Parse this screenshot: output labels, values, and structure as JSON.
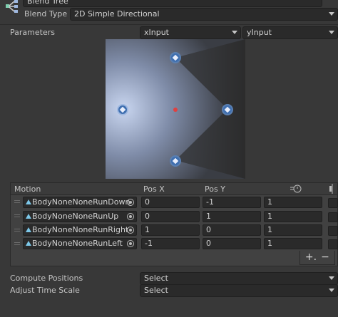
{
  "header": {
    "tree_name": "Blend Tree",
    "blend_type_label": "Blend Type",
    "blend_type_value": "2D Simple Directional"
  },
  "parameters": {
    "label": "Parameters",
    "x_param": "xInput",
    "y_param": "yInput"
  },
  "table": {
    "headers": {
      "motion": "Motion",
      "pos_x": "Pos X",
      "pos_y": "Pos Y"
    },
    "rows": [
      {
        "motion": "BodyNoneNoneRunDown",
        "pos_x": "0",
        "pos_y": "-1",
        "speed": "1"
      },
      {
        "motion": "BodyNoneNoneRunUp",
        "pos_x": "0",
        "pos_y": "1",
        "speed": "1"
      },
      {
        "motion": "BodyNoneNoneRunRight",
        "pos_x": "1",
        "pos_y": "0",
        "speed": "1"
      },
      {
        "motion": "BodyNoneNoneRunLeft",
        "pos_x": "-1",
        "pos_y": "0",
        "speed": "1"
      }
    ],
    "add_label": "+.",
    "remove_label": "−"
  },
  "options": {
    "compute_positions_label": "Compute Positions",
    "compute_positions_value": "Select",
    "adjust_time_scale_label": "Adjust Time Scale",
    "adjust_time_scale_value": "Select"
  },
  "colors": {
    "accent": "#3f6fb0",
    "current_point": "#e04040"
  }
}
